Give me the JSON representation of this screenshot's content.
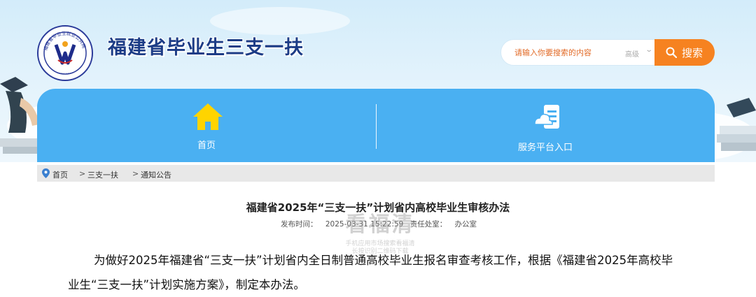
{
  "header": {
    "site_title": "福建省毕业生三支一扶",
    "logo_ring_text": "福建省毕业生就业公共网"
  },
  "search": {
    "placeholder": "请输入你要搜索的内容",
    "advanced_label": "高级",
    "button_label": "搜索"
  },
  "nav": {
    "items": [
      {
        "label": "首页",
        "icon": "house-icon"
      },
      {
        "label": "服务平台入口",
        "icon": "service-platform-icon"
      }
    ]
  },
  "breadcrumb": {
    "items": [
      "首页",
      "三支一扶",
      "通知公告"
    ],
    "separator": ">"
  },
  "article": {
    "title": "福建省2025年“三支一扶”计划省内高校毕业生审核办法",
    "meta_label_time": "发布时间：",
    "publish_time": "2025-03-31 15:22:59",
    "meta_label_office": "责任处室：",
    "office": "办公室",
    "body": "为做好2025年福建省“三支一扶”计划省内全日制普通高校毕业生报名审查考核工作，根据《福建省2025年高校毕业生“三支一扶”计划实施方案》，制定本办法。"
  },
  "watermark": {
    "main": "看福清",
    "sub1": "手机应用市场搜索看福清",
    "sub2": "长按识别二维码下载"
  },
  "colors": {
    "nav_blue": "#4ab0f2",
    "search_orange": "#f68220",
    "title_navy": "#1c3c86",
    "house_yellow": "#ffd400"
  }
}
